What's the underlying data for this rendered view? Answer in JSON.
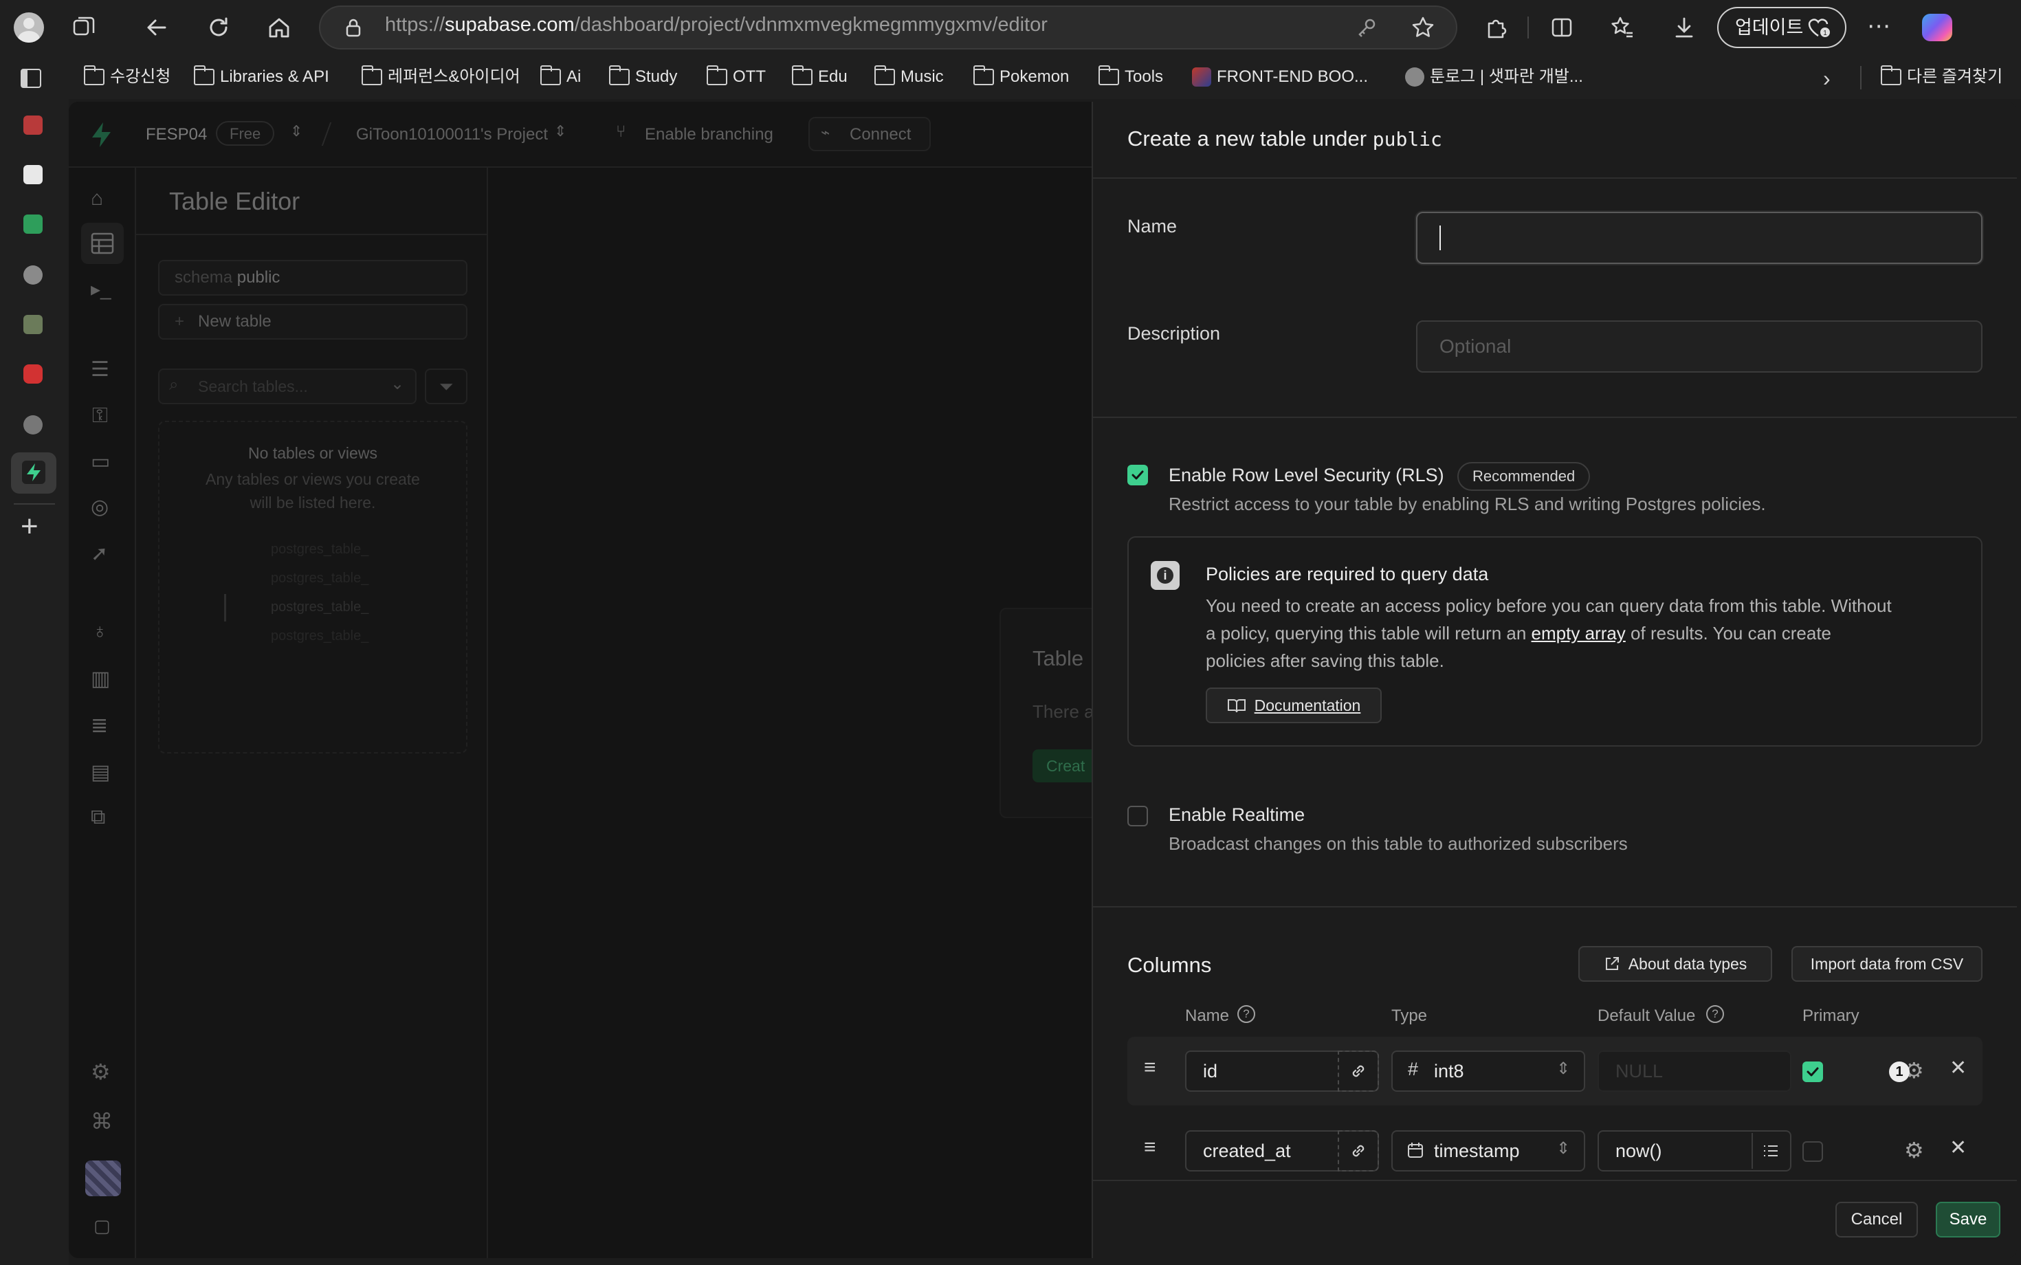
{
  "browser": {
    "url_prefix": "https://",
    "url_domain": "supabase.com",
    "url_path": "/dashboard/project/vdnmxmvegkmegmmygxmv/editor",
    "update_label": "업데이트",
    "bookmarks": [
      {
        "label": "수강신청",
        "icon": "folder-icon"
      },
      {
        "label": "Libraries & API",
        "icon": "folder-icon"
      },
      {
        "label": "레퍼런스&아이디어",
        "icon": "folder-icon"
      },
      {
        "label": "Ai",
        "icon": "folder-icon"
      },
      {
        "label": "Study",
        "icon": "folder-icon"
      },
      {
        "label": "OTT",
        "icon": "folder-icon"
      },
      {
        "label": "Edu",
        "icon": "folder-icon"
      },
      {
        "label": "Music",
        "icon": "folder-icon"
      },
      {
        "label": "Pokemon",
        "icon": "folder-icon"
      },
      {
        "label": "Tools",
        "icon": "folder-icon"
      },
      {
        "label": "FRONT-END BOO...",
        "icon": "site-icon"
      },
      {
        "label": "툰로그 | 샛파란 개발...",
        "icon": "site-icon"
      }
    ],
    "other_bookmarks": "다른 즐겨찾기"
  },
  "app": {
    "org": "FESP04",
    "plan": "Free",
    "project": "GiToon10100011's Project",
    "branching": "Enable branching",
    "connect": "Connect",
    "title": "Table Editor",
    "schema_prefix": "schema",
    "schema_value": "public",
    "new_table": "New table",
    "search_placeholder": "Search tables...",
    "empty_title": "No tables or views",
    "empty_desc_1": "Any tables or views you create",
    "empty_desc_2": "will be listed here.",
    "ghost_rows": [
      "postgres_table_",
      "postgres_table_",
      "postgres_table_",
      "postgres_table_"
    ],
    "card_title": "Table",
    "card_text": "There a",
    "card_button": "Creat"
  },
  "panel": {
    "title_text": "Create a new table under",
    "title_schema": "public",
    "name_label": "Name",
    "name_value": "",
    "description_label": "Description",
    "description_placeholder": "Optional",
    "rls_label": "Enable Row Level Security (RLS)",
    "rls_badge": "Recommended",
    "rls_checked": true,
    "rls_desc": "Restrict access to your table by enabling RLS and writing Postgres policies.",
    "notice_title": "Policies are required to query data",
    "notice_line1": "You need to create an access policy before you can query data from this table. Without",
    "notice_line2_a": "a policy, querying this table will return an",
    "notice_link": "empty array",
    "notice_line2_b": "of results. You can create",
    "notice_line3": "policies after saving this table.",
    "doc_button": "Documentation",
    "realtime_label": "Enable Realtime",
    "realtime_checked": false,
    "realtime_desc": "Broadcast changes on this table to authorized subscribers",
    "columns_title": "Columns",
    "about_types": "About data types",
    "import_csv": "Import data from CSV",
    "col_headers": {
      "name": "Name",
      "type": "Type",
      "default": "Default Value",
      "primary": "Primary"
    },
    "columns": [
      {
        "name": "id",
        "type": "int8",
        "type_icon": "hash-icon",
        "default": "",
        "default_placeholder": "NULL",
        "primary": true
      },
      {
        "name": "created_at",
        "type": "timestamp",
        "type_icon": "calendar-icon",
        "default": "now()",
        "default_placeholder": "",
        "primary": false
      }
    ],
    "badge_count": "1",
    "cancel": "Cancel",
    "save": "Save"
  },
  "colors": {
    "accent": "#3ecf8e",
    "save_bg": "#1f4d35",
    "panel_bg": "#1c1c1c"
  }
}
